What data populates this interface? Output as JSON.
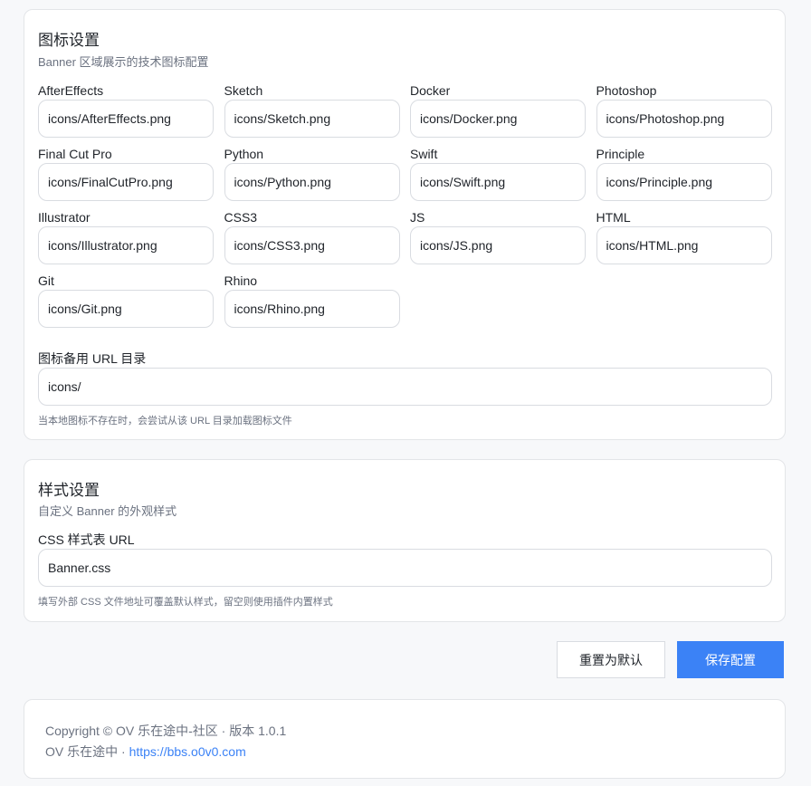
{
  "icon_settings": {
    "title": "图标设置",
    "subtitle": "Banner 区域展示的技术图标配置",
    "icons": [
      {
        "label": "AfterEffects",
        "value": "icons/AfterEffects.png"
      },
      {
        "label": "Sketch",
        "value": "icons/Sketch.png"
      },
      {
        "label": "Docker",
        "value": "icons/Docker.png"
      },
      {
        "label": "Photoshop",
        "value": "icons/Photoshop.png"
      },
      {
        "label": "Final Cut Pro",
        "value": "icons/FinalCutPro.png"
      },
      {
        "label": "Python",
        "value": "icons/Python.png"
      },
      {
        "label": "Swift",
        "value": "icons/Swift.png"
      },
      {
        "label": "Principle",
        "value": "icons/Principle.png"
      },
      {
        "label": "Illustrator",
        "value": "icons/Illustrator.png"
      },
      {
        "label": "CSS3",
        "value": "icons/CSS3.png"
      },
      {
        "label": "JS",
        "value": "icons/JS.png"
      },
      {
        "label": "HTML",
        "value": "icons/HTML.png"
      },
      {
        "label": "Git",
        "value": "icons/Git.png"
      },
      {
        "label": "Rhino",
        "value": "icons/Rhino.png"
      }
    ],
    "fallback_url": {
      "label": "图标备用 URL 目录",
      "value": "icons/",
      "hint": "当本地图标不存在时，会尝试从该 URL 目录加载图标文件"
    }
  },
  "style_settings": {
    "title": "样式设置",
    "subtitle": "自定义 Banner 的外观样式",
    "css_url": {
      "label": "CSS 样式表 URL",
      "value": "Banner.css",
      "hint": "填写外部 CSS 文件地址可覆盖默认样式，留空则使用插件内置样式"
    }
  },
  "actions": {
    "reset_label": "重置为默认",
    "save_label": "保存配置"
  },
  "footer": {
    "copyright": "Copyright © OV 乐在途中-社区 · 版本 1.0.1",
    "site_prefix": "OV 乐在途中 · ",
    "site_link": "https://bbs.o0v0.com"
  },
  "colors": {
    "accent": "#3b82f6",
    "border": "#d9dce1",
    "background": "#f7f8fa"
  }
}
